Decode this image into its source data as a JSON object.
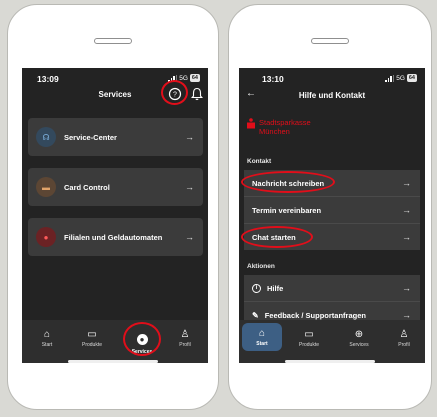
{
  "left": {
    "time": "13:09",
    "network": "5G",
    "battery": "64",
    "title": "Services",
    "cards": [
      {
        "label": "Service-Center",
        "icon": "headset-icon"
      },
      {
        "label": "Card Control",
        "icon": "card-icon"
      },
      {
        "label": "Filialen und Geldautomaten",
        "icon": "location-icon"
      }
    ],
    "tabs": [
      {
        "label": "Start",
        "icon": "home-icon"
      },
      {
        "label": "Produkte",
        "icon": "wallet-icon"
      },
      {
        "label": "Services",
        "icon": "services-icon"
      },
      {
        "label": "Profil",
        "icon": "person-icon"
      }
    ]
  },
  "right": {
    "time": "13:10",
    "network": "5G",
    "battery": "64",
    "title": "Hilfe und Kontakt",
    "brand_line1": "Stadtsparkasse",
    "brand_line2": "München",
    "section_kontakt": "Kontakt",
    "kontakt_items": [
      "Nachricht schreiben",
      "Termin vereinbaren",
      "Chat starten"
    ],
    "section_aktionen": "Aktionen",
    "aktionen_items": [
      "Hilfe",
      "Feedback / Supportanfragen"
    ],
    "tabs": [
      {
        "label": "Start",
        "icon": "home-icon"
      },
      {
        "label": "Produkte",
        "icon": "wallet-icon"
      },
      {
        "label": "Services",
        "icon": "services-icon"
      },
      {
        "label": "Profil",
        "icon": "person-icon"
      }
    ]
  },
  "colors": {
    "accent_red": "#e10e1a",
    "screen_bg": "#232323",
    "card_bg": "#3b3b3b"
  }
}
